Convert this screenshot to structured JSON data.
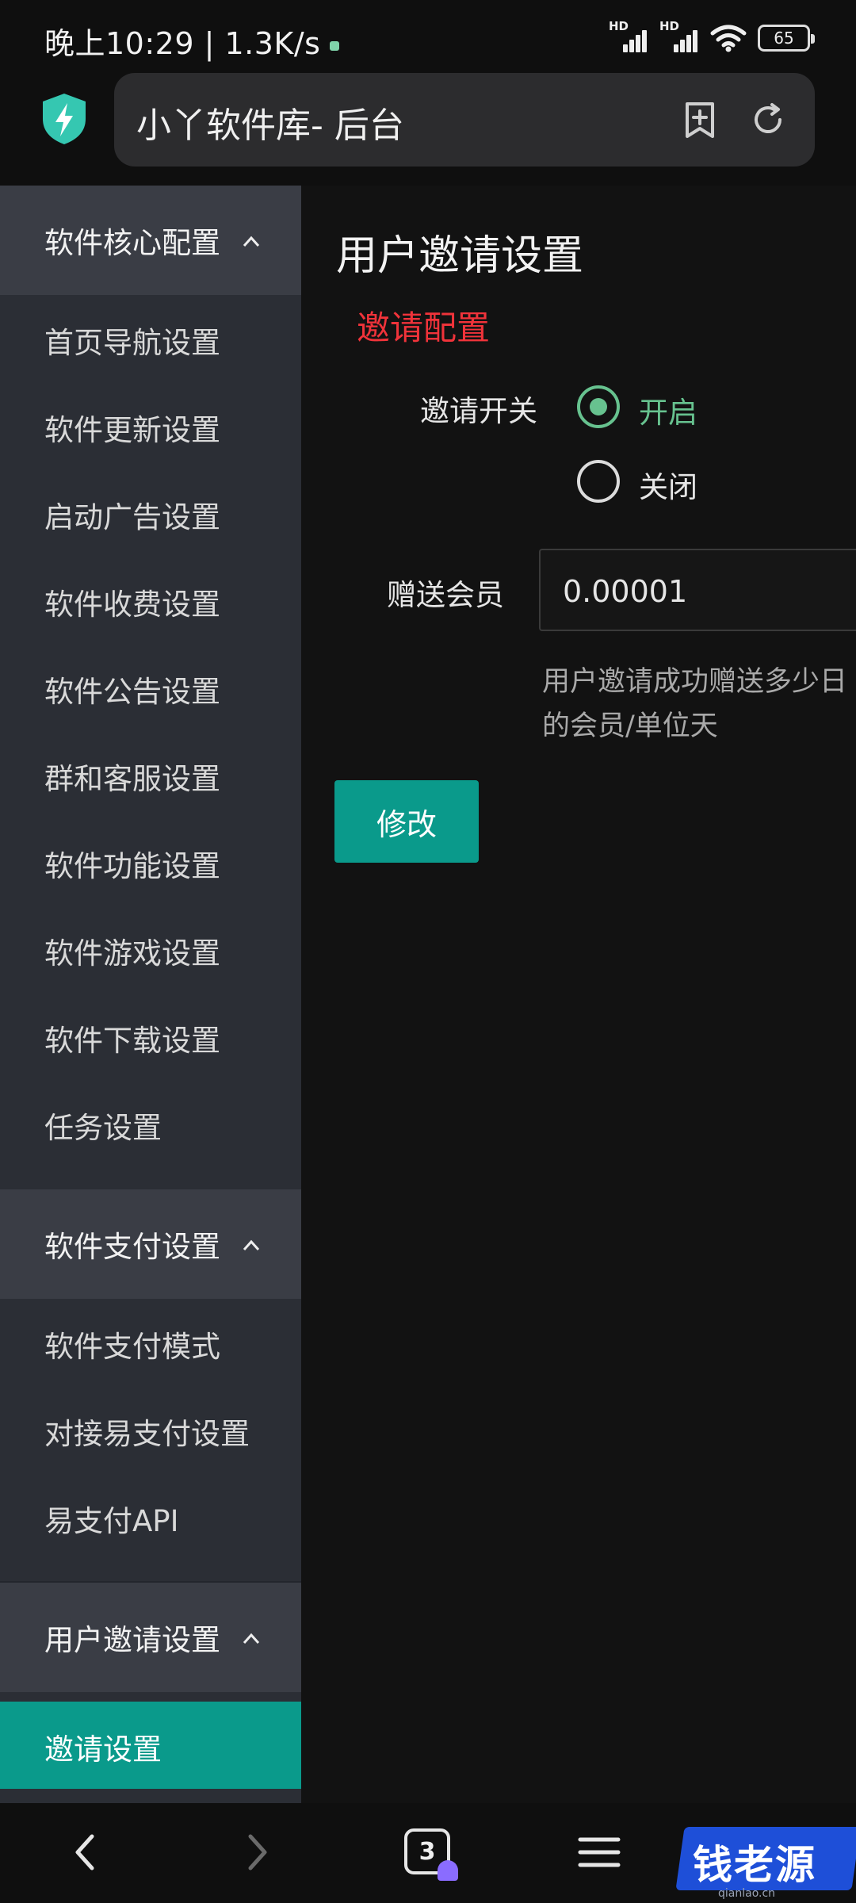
{
  "status_bar": {
    "time_speed": "晚上10:29 | 1.3K/s",
    "signal1_label": "HD",
    "signal2_label": "HD",
    "battery": "65"
  },
  "browser": {
    "title": "小丫软件库- 后台",
    "tab_count": "3"
  },
  "sidebar": {
    "groups": [
      {
        "title": "软件核心配置",
        "items": [
          "首页导航设置",
          "软件更新设置",
          "启动广告设置",
          "软件收费设置",
          "软件公告设置",
          "群和客服设置",
          "软件功能设置",
          "软件游戏设置",
          "软件下载设置",
          "任务设置"
        ]
      },
      {
        "title": "软件支付设置",
        "items": [
          "软件支付模式",
          "对接易支付设置",
          "易支付API"
        ]
      },
      {
        "title": "用户邀请设置",
        "items": [
          "邀请设置"
        ]
      }
    ]
  },
  "main": {
    "page_title": "用户邀请设置",
    "section_title": "邀请配置",
    "invite_switch": {
      "label": "邀请开关",
      "options": [
        "开启",
        "关闭"
      ],
      "selected": "开启"
    },
    "gift_member": {
      "label": "赠送会员",
      "value": "0.00001",
      "hint_line1": "用户邀请成功赠送多少日",
      "hint_line2": "的会员/单位天"
    },
    "submit_label": "修改"
  },
  "watermark": {
    "text": "钱老源码",
    "sub": "qianlao.cn"
  },
  "colors": {
    "accent_teal": "#0a9a8b",
    "radio_green": "#67c28f",
    "section_red": "#f0333a"
  }
}
